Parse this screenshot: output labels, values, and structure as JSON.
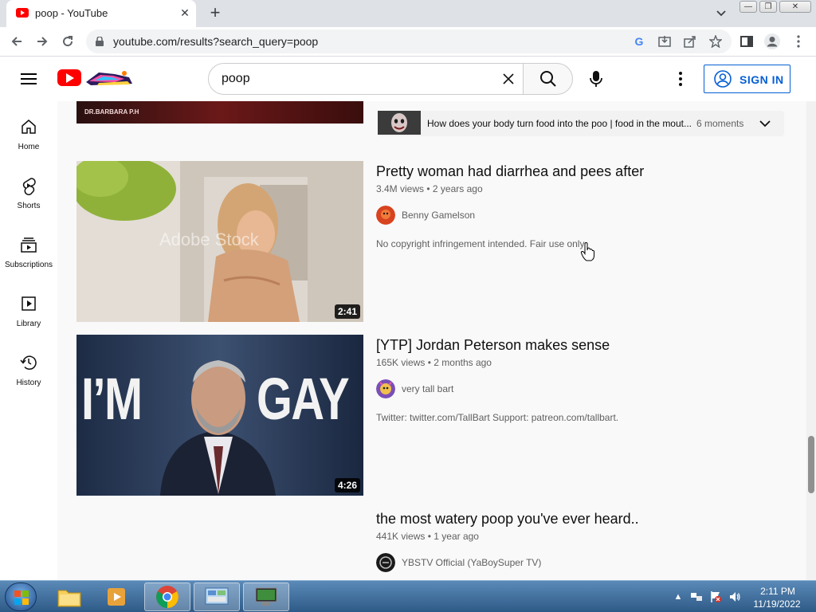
{
  "browser": {
    "tab_title": "poop - YouTube",
    "tab_close": "✕",
    "new_tab": "+",
    "url": "youtube.com/results?search_query=poop"
  },
  "youtube": {
    "search_value": "poop",
    "sign_in_label": "SIGN IN"
  },
  "guide": {
    "items": [
      {
        "label": "Home",
        "icon": "home-icon"
      },
      {
        "label": "Shorts",
        "icon": "shorts-icon"
      },
      {
        "label": "Subscriptions",
        "icon": "subscriptions-icon"
      },
      {
        "label": "Library",
        "icon": "library-icon"
      },
      {
        "label": "History",
        "icon": "history-icon"
      }
    ]
  },
  "results": {
    "partial_thumb_text": "DR.BARBARA P.H",
    "moments": {
      "text": "How does your body turn food into the poo | food in the mout...",
      "count": "6 moments"
    },
    "videos": [
      {
        "title": "Pretty woman had diarrhea and pees after",
        "views": "3.4M views",
        "age": "2 years ago",
        "channel": "Benny Gamelson",
        "description": "No copyright infringement intended. Fair use only.",
        "duration": "2:41",
        "watermark": "Adobe Stock"
      },
      {
        "title": "[YTP] Jordan Peterson makes sense",
        "views": "165K views",
        "age": "2 months ago",
        "channel": "very tall bart",
        "description": "Twitter: twitter.com/TallBart Support: patreon.com/tallbart.",
        "duration": "4:26",
        "thumb_text_left": "I’M",
        "thumb_text_right": "GAY"
      },
      {
        "title": "the most watery poop you've ever heard..",
        "views": "441K views",
        "age": "1 year ago",
        "channel": "YBSTV Official (YaBoySuper TV)"
      }
    ]
  },
  "taskbar": {
    "time": "2:11 PM",
    "date": "11/19/2022"
  },
  "colors": {
    "youtube_red": "#ff0000",
    "link_blue": "#065fd4",
    "results_bg": "#f9f9f9",
    "taskbar": "#2e5a87"
  }
}
